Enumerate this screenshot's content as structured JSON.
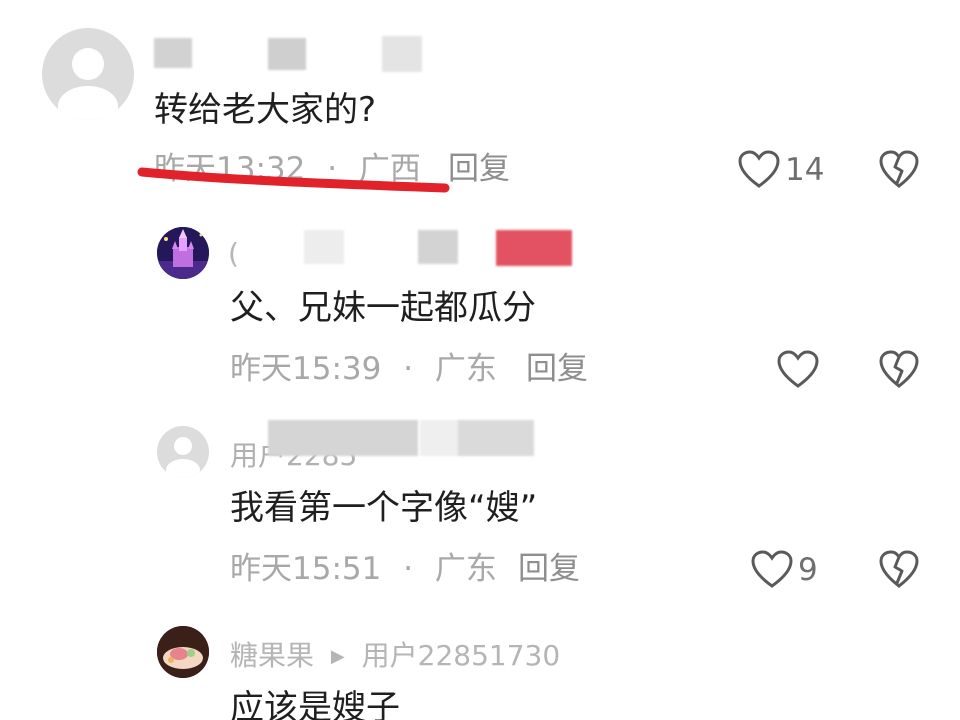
{
  "comments": [
    {
      "text": "转给老大家的?",
      "time": "昨天13:32",
      "location": "广西",
      "reply_label": "回复",
      "like_count": "14"
    },
    {
      "text": "父、兄妹一起都瓜分",
      "time": "昨天15:39",
      "location": "广东",
      "reply_label": "回复"
    },
    {
      "username": "用户2285",
      "text": "我看第一个字像“嫂”",
      "time": "昨天15:51",
      "location": "广东",
      "reply_label": "回复",
      "like_count": "9"
    },
    {
      "username": "糖果果",
      "reply_to": "用户22851730",
      "text": "应该是嫂子"
    }
  ],
  "separator": "·",
  "colors": {
    "underline": "#e1222a",
    "text": "#1f1f1f",
    "meta": "#a8a8a8",
    "icon": "#5a5a5a"
  },
  "icons": {
    "like": "heart-outline-icon",
    "dislike": "broken-heart-icon",
    "arrow": "play-arrow-icon"
  }
}
